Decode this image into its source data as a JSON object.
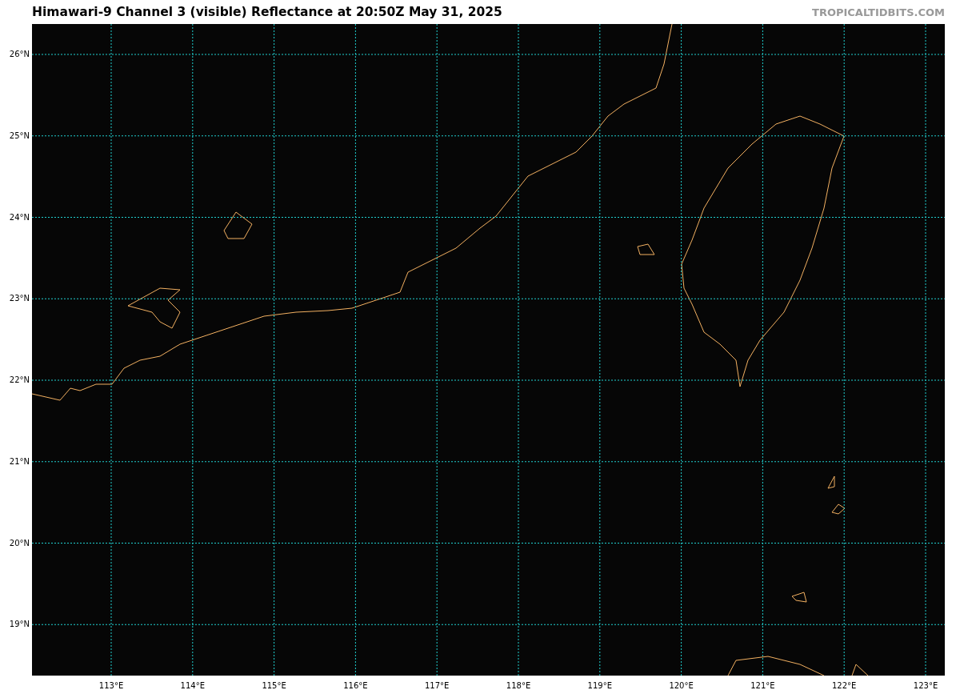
{
  "title": "Himawari-9 Channel 3 (visible) Reflectance at 20:50Z May 31, 2025",
  "credit": "TROPICALTIDBITS.COM",
  "map": {
    "lat_labels": [
      "26°N",
      "25°N",
      "24°N",
      "23°N",
      "22°N",
      "21°N",
      "20°N",
      "19°N"
    ],
    "lon_labels": [
      "113°E",
      "114°E",
      "115°E",
      "116°E",
      "117°E",
      "118°E",
      "119°E",
      "120°E",
      "121°E",
      "122°E",
      "123°E"
    ]
  }
}
